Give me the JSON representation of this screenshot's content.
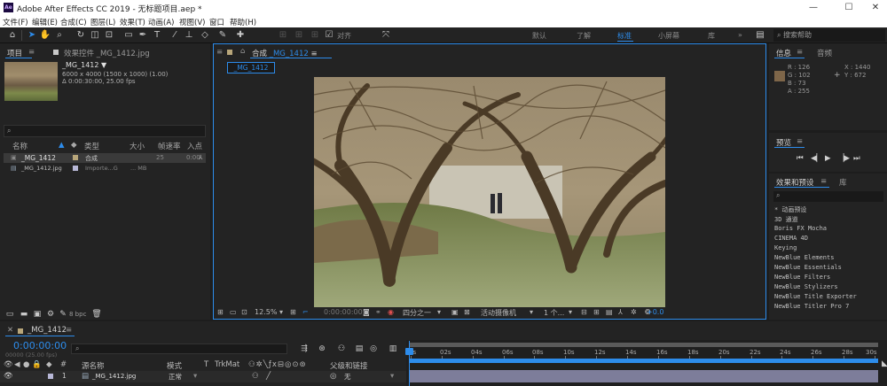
{
  "window": {
    "app_icon": "Ae",
    "title": "Adobe After Effects CC 2019 - 无标题项目.aep *",
    "controls": [
      "—",
      "☐",
      "✕"
    ]
  },
  "menu": [
    "文件(F)",
    "编辑(E)",
    "合成(C)",
    "图层(L)",
    "效果(T)",
    "动画(A)",
    "视图(V)",
    "窗口",
    "帮助(H)"
  ],
  "toolbar": {
    "align_label": "对齐",
    "workspaces": [
      "默认",
      "了解",
      "标准",
      "小屏幕",
      "库"
    ],
    "active_workspace": "标准",
    "search_help_placeholder": "搜索帮助",
    "overflow": "»"
  },
  "project": {
    "tabs": [
      "项目",
      "效果控件 _MG_1412.jpg"
    ],
    "selected_name": "_MG_1412",
    "meta_lines": [
      "6000 x 4000 (1500 x 1000) (1.00)",
      "Δ 0:00:30:00, 25.00 fps"
    ],
    "columns": [
      "名称",
      "类型",
      "大小",
      "帧速率",
      "入点"
    ],
    "items": [
      {
        "name": "_MG_1412",
        "type": "合成",
        "size": "",
        "fps": "25",
        "in": "0:00"
      },
      {
        "name": "_MG_1412.jpg",
        "type": "Importe...G",
        "size": "... MB",
        "fps": "",
        "in": ""
      }
    ],
    "bpc": "8 bpc"
  },
  "composition": {
    "tab_label": "合成",
    "comp_name": "_MG_1412",
    "breadcrumb": "_MG_1412",
    "footer": {
      "zoom": "12.5%",
      "timecode": "0:00:00:00",
      "resolution": "四分之一",
      "camera": "活动摄像机",
      "views": "1 个...",
      "exposure": "+0.0"
    }
  },
  "info": {
    "tabs": [
      "信息",
      "音频"
    ],
    "rgba": [
      "R : 126",
      "G : 102",
      "B : 73",
      "A : 255"
    ],
    "xy": [
      "X : 1440",
      "Y : 672"
    ],
    "sample_color": "#7e6649"
  },
  "preview": {
    "title": "预览",
    "controls": [
      "⏮",
      "◀|",
      "▶",
      "|▶",
      "⏭"
    ]
  },
  "effects": {
    "tabs": [
      "效果和预设",
      "库"
    ],
    "items": [
      "* 动画预设",
      "3D 通道",
      "Boris FX Mocha",
      "CINEMA 4D",
      "Keying",
      "NewBlue Elements",
      "NewBlue Essentials",
      "NewBlue Filters",
      "NewBlue Stylizers",
      "NewBlue Title Exporter",
      "NewBlue Titler Pro 7"
    ]
  },
  "timeline": {
    "tab": "_MG_1412",
    "timecode": "0:00:00:00",
    "frames": "00000 (25.00 fps)",
    "columns": [
      "#",
      "源名称",
      "模式",
      "T",
      "TrkMat",
      "父级和链接"
    ],
    "layer": {
      "index": "1",
      "name": "_MG_1412.jpg",
      "mode": "正常",
      "parent": "无"
    },
    "ruler": [
      "0s",
      "02s",
      "04s",
      "06s",
      "08s",
      "10s",
      "12s",
      "14s",
      "16s",
      "18s",
      "20s",
      "22s",
      "24s",
      "26s",
      "28s",
      "30s"
    ]
  },
  "colors": {
    "accent": "#2d8ceb",
    "panel_bg": "#232323",
    "app_bg": "#1d1d1d"
  }
}
